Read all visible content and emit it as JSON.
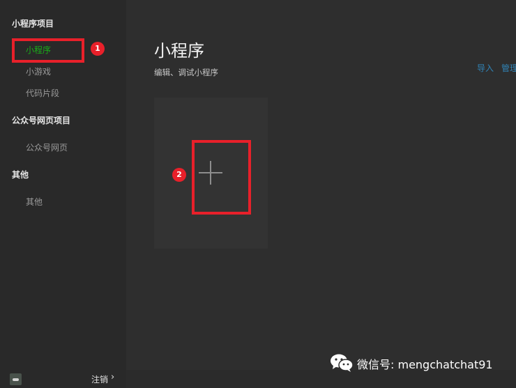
{
  "sidebar": {
    "section_miniprogram": "小程序项目",
    "item_miniprogram": "小程序",
    "item_minigame": "小游戏",
    "item_snippet": "代码片段",
    "section_official": "公众号网页项目",
    "item_official_web": "公众号网页",
    "section_other": "其他",
    "item_other": "其他",
    "active_item": "小程序",
    "logout": "注销",
    "logout_arrow": "›"
  },
  "main": {
    "title": "小程序",
    "subtitle": "编辑、调试小程序",
    "import_link": "导入",
    "manage_link": "管理"
  },
  "annotations": {
    "badge_1": "1",
    "badge_2": "2"
  },
  "watermark": {
    "text": "微信号: mengchatchat91"
  },
  "colors": {
    "active_green": "#1aad19",
    "link_blue": "#3083b5",
    "annotation_red": "#e8202a"
  },
  "icons": {
    "add": "plus-icon",
    "watermark": "wechat-icon",
    "avatar": "avatar-icon"
  }
}
